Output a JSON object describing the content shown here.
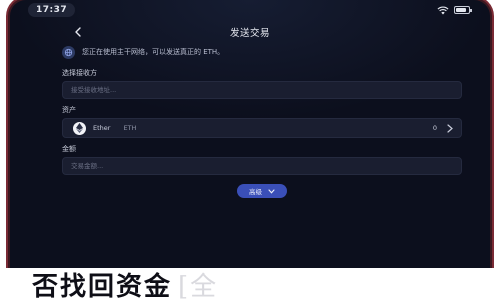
{
  "status_bar": {
    "time": "17:37",
    "battery_level": 0.85
  },
  "nav": {
    "title": "发送交易"
  },
  "notice": {
    "text": "您正在使用主干网络，可以发送真正的 ETH。"
  },
  "address": {
    "label": "选择接收方",
    "placeholder": "接受接收地址..."
  },
  "asset": {
    "label": "资产",
    "name": "Ether",
    "symbol": "ETH",
    "balance": "0"
  },
  "amount": {
    "label": "金额",
    "placeholder": "交易金额..."
  },
  "advanced_button": {
    "label": "高级"
  },
  "banner": {
    "text": "否找回资金",
    "faded": "[全"
  },
  "colors": {
    "accent": "#3a4fb8",
    "background": "#0c0f1d",
    "frame": "#7a2a34"
  }
}
